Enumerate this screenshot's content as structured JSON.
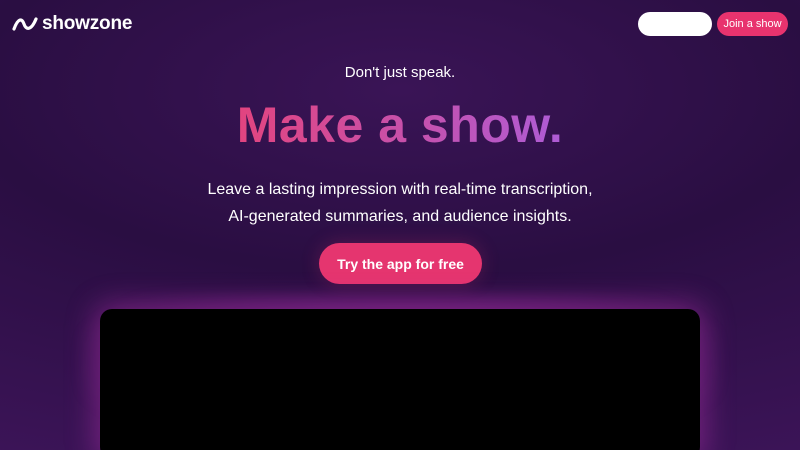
{
  "brand": {
    "name": "showzone",
    "logo_icon": "wave-icon",
    "accent": "#e8336e"
  },
  "nav": {
    "blank_button_label": "",
    "join_label": "Join a show"
  },
  "hero": {
    "tagline": "Don't just speak.",
    "headline": "Make a show.",
    "description_line1": "Leave a lasting impression with real-time transcription,",
    "description_line2": "AI-generated summaries, and audience insights.",
    "cta_label": "Try the app for free"
  },
  "colors": {
    "background": "#2e1046",
    "cta": "#e5356f",
    "headline_gradient_start": "#e2447f",
    "headline_gradient_end": "#ae5cd6",
    "panel": "#000000"
  }
}
